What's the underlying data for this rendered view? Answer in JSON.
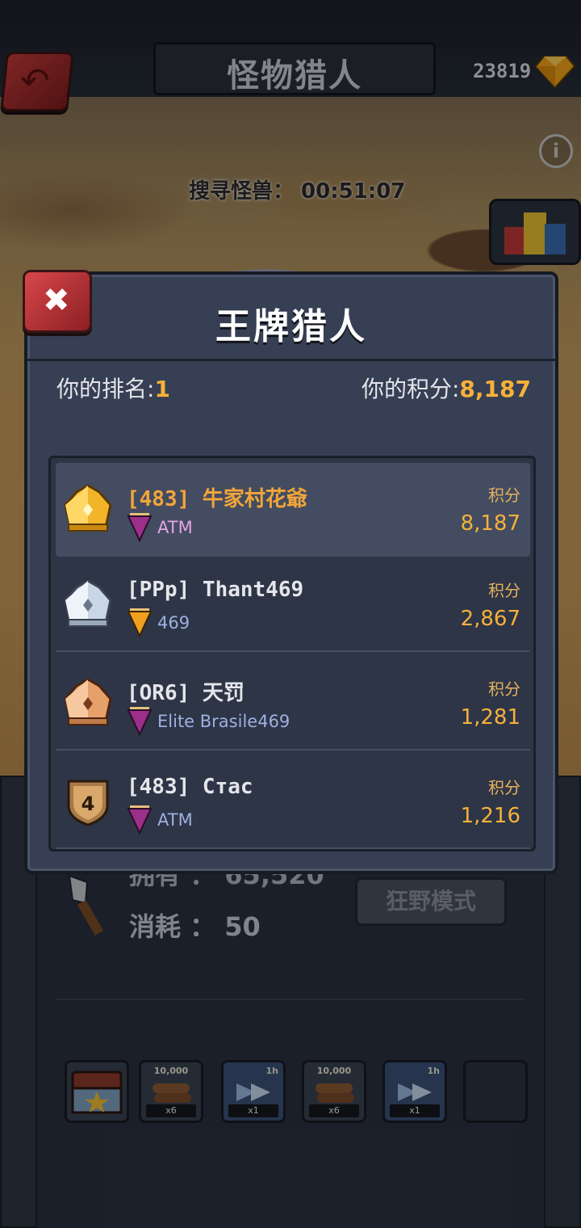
{
  "header": {
    "title": "怪物猎人",
    "currency": "23819"
  },
  "hunt": {
    "search_timer": "搜寻怪兽： 00:51:07"
  },
  "modal": {
    "title": "王牌猎人",
    "my_rank_label": "你的排名:",
    "my_rank_value": "1",
    "my_score_label": "你的积分:",
    "my_score_value": "8,187",
    "rows": [
      {
        "rank": 1,
        "badge": "gold-crown-icon",
        "name": "[483] 牛家村花爺",
        "guild": "ATM",
        "flag_color": "#9b2f8a",
        "score_label": "积分",
        "score": "8,187"
      },
      {
        "rank": 2,
        "badge": "silver-crown-icon",
        "name": "[PPp] Thant469",
        "guild": "469",
        "flag_color": "#f0a020",
        "score_label": "积分",
        "score": "2,867"
      },
      {
        "rank": 3,
        "badge": "bronze-crown-icon",
        "name": "[OR6] 天罚",
        "guild": "Elite Brasile469",
        "flag_color": "#9b2f8a",
        "score_label": "积分",
        "score": "1,281"
      },
      {
        "rank": 4,
        "badge": "rank-4-shield-icon",
        "badge_text": "4",
        "name": "[483] Стас",
        "guild": "ATM",
        "flag_color": "#9b2f8a",
        "score_label": "积分",
        "score": "1,216"
      }
    ]
  },
  "lower": {
    "hold_text": "拥有 ： 65,520",
    "consume_text": "消耗 ： 50",
    "wild_mode": "狂野模式",
    "slots": [
      {
        "top": "",
        "tag": "",
        "icon": "chest-icon"
      },
      {
        "top": "10,000",
        "tag": "x6",
        "icon": "logs-icon"
      },
      {
        "top": "1h",
        "tag": "x1",
        "icon": "speedup-icon"
      },
      {
        "top": "10,000",
        "tag": "x6",
        "icon": "logs-icon"
      },
      {
        "top": "1h",
        "tag": "x1",
        "icon": "arrow-icon"
      },
      {
        "top": "",
        "tag": "",
        "icon": ""
      }
    ]
  },
  "colors": {
    "accent": "#f6b13a",
    "panel": "#363f53",
    "close": "#d8474a"
  }
}
